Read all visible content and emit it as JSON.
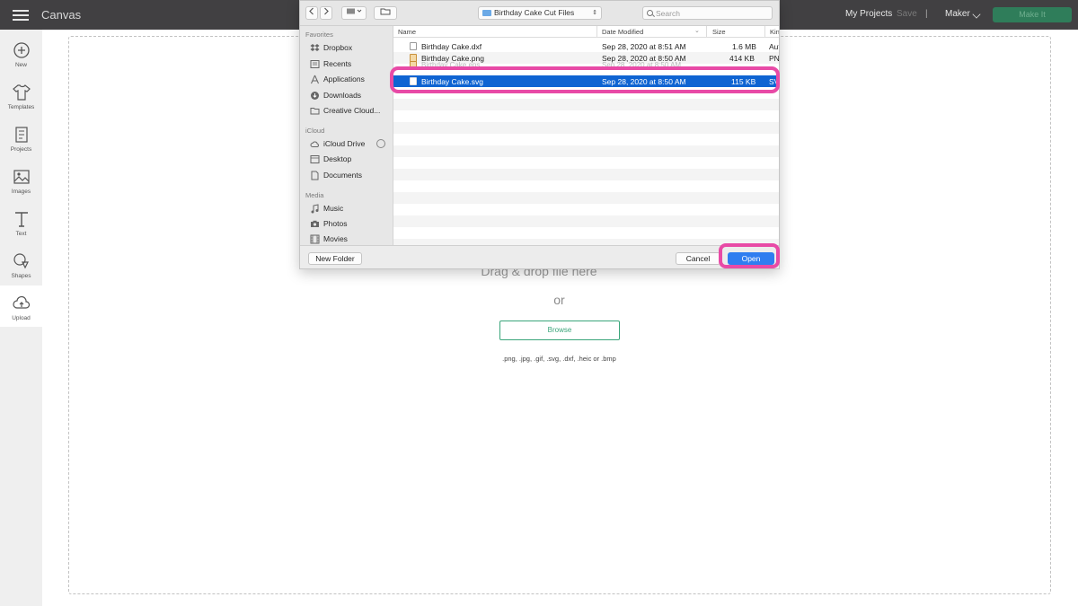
{
  "topbar": {
    "title": "Canvas",
    "my_projects": "My Projects",
    "save": "Save",
    "separator": "|",
    "machine": "Maker",
    "make_it": "Make It"
  },
  "leftnav": {
    "items": [
      {
        "label": "New",
        "icon": "plus-circle-icon"
      },
      {
        "label": "Templates",
        "icon": "tshirt-icon"
      },
      {
        "label": "Projects",
        "icon": "projects-icon"
      },
      {
        "label": "Images",
        "icon": "image-icon"
      },
      {
        "label": "Text",
        "icon": "text-icon"
      },
      {
        "label": "Shapes",
        "icon": "shapes-icon"
      },
      {
        "label": "Upload",
        "icon": "cloud-upload-icon",
        "active": true
      }
    ]
  },
  "upload": {
    "drag_text": "Drag & drop file here",
    "or_text": "or",
    "browse": "Browse",
    "formats": ".png, .jpg, .gif, .svg, .dxf, .heic or .bmp"
  },
  "dialog": {
    "folder": "Birthday Cake Cut Files",
    "search_placeholder": "Search",
    "sidebar": {
      "favorites_header": "Favorites",
      "favorites": [
        "Dropbox",
        "Recents",
        "Applications",
        "Downloads",
        "Creative Cloud..."
      ],
      "icloud_header": "iCloud",
      "icloud": [
        "iCloud Drive",
        "Desktop",
        "Documents"
      ],
      "media_header": "Media",
      "media": [
        "Music",
        "Photos",
        "Movies"
      ]
    },
    "columns": {
      "name": "Name",
      "date": "Date Modified",
      "size": "Size",
      "kind": "Kin"
    },
    "files": [
      {
        "name": "Birthday Cake.dxf",
        "date": "Sep 28, 2020 at 8:51 AM",
        "size": "1.6 MB",
        "kind": "Aut"
      },
      {
        "name": "Birthday Cake.png",
        "date": "Sep 28, 2020 at 8:50 AM",
        "size": "414 KB",
        "kind": "PN"
      },
      {
        "name": "Birthday Cake.eps",
        "date": "Sep 28, 2020 at 8:50 AM",
        "size": "",
        "kind": ""
      },
      {
        "name": "Birthday Cake.svg",
        "date": "Sep 28, 2020 at 8:50 AM",
        "size": "115 KB",
        "kind": "SV",
        "selected": true
      }
    ],
    "new_folder": "New Folder",
    "cancel": "Cancel",
    "open": "Open"
  },
  "colors": {
    "highlight": "#e84aa6",
    "selection": "#0f64d2",
    "browse_green": "#3aa57a",
    "topbar": "#414042"
  }
}
